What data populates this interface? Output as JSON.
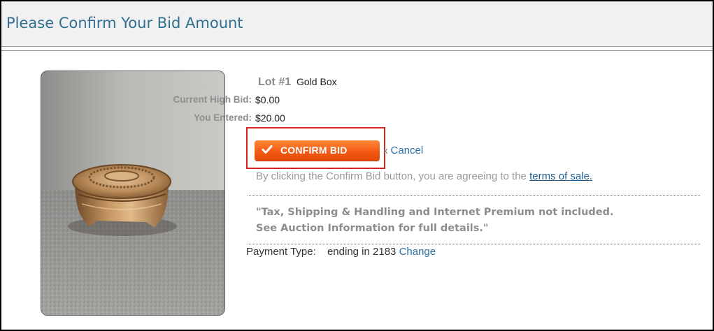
{
  "header": {
    "title": "Please Confirm Your Bid Amount"
  },
  "lot": {
    "label": "Lot #1",
    "name": "Gold Box"
  },
  "bid": {
    "current_label": "Current High Bid:",
    "current_value": "$0.00",
    "entered_label": "You Entered:",
    "entered_value": "$20.00"
  },
  "actions": {
    "confirm_label": "CONFIRM BID",
    "cancel_label": "Cancel"
  },
  "agreement": {
    "prefix": "By clicking the Confirm Bid button, you are agreeing to the ",
    "link": "terms of sale."
  },
  "notice": {
    "line1": "\"Tax, Shipping & Handling and Internet Premium not included.",
    "line2": "See Auction Information for full details.\""
  },
  "payment": {
    "label": "Payment Type:",
    "value": "ending in 2183",
    "change": "Change"
  },
  "colors": {
    "title": "#2f6f91",
    "button": "#f35a12",
    "highlight": "#d2261f",
    "link": "#2b6fa4"
  }
}
